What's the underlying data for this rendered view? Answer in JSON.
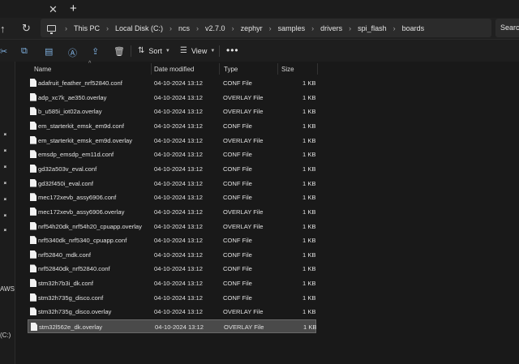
{
  "window": {
    "tab_close_glyph": "✕",
    "tab_new_glyph": "+"
  },
  "nav": {
    "up_icon": "arrow-up-icon",
    "refresh_icon": "refresh-icon"
  },
  "breadcrumb": [
    "This PC",
    "Local Disk (C:)",
    "ncs",
    "v2.7.0",
    "zephyr",
    "samples",
    "drivers",
    "spi_flash",
    "boards"
  ],
  "search": {
    "placeholder": "Search"
  },
  "toolbar": {
    "sort_label": "Sort",
    "view_label": "View",
    "more_label": "•••"
  },
  "sidebar": {
    "partial_labels": [
      "AWS",
      "(C:)"
    ]
  },
  "columns": {
    "name": "Name",
    "date": "Date modified",
    "type": "Type",
    "size": "Size"
  },
  "files": [
    {
      "name": "adafruit_feather_nrf52840.conf",
      "date": "04-10-2024 13:12",
      "type": "CONF File",
      "size": "1 KB"
    },
    {
      "name": "adp_xc7k_ae350.overlay",
      "date": "04-10-2024 13:12",
      "type": "OVERLAY File",
      "size": "1 KB"
    },
    {
      "name": "b_u585i_iot02a.overlay",
      "date": "04-10-2024 13:12",
      "type": "OVERLAY File",
      "size": "1 KB"
    },
    {
      "name": "em_starterkit_emsk_em9d.conf",
      "date": "04-10-2024 13:12",
      "type": "CONF File",
      "size": "1 KB"
    },
    {
      "name": "em_starterkit_emsk_em9d.overlay",
      "date": "04-10-2024 13:12",
      "type": "OVERLAY File",
      "size": "1 KB"
    },
    {
      "name": "emsdp_emsdp_em11d.conf",
      "date": "04-10-2024 13:12",
      "type": "CONF File",
      "size": "1 KB"
    },
    {
      "name": "gd32a503v_eval.conf",
      "date": "04-10-2024 13:12",
      "type": "CONF File",
      "size": "1 KB"
    },
    {
      "name": "gd32f450i_eval.conf",
      "date": "04-10-2024 13:12",
      "type": "CONF File",
      "size": "1 KB"
    },
    {
      "name": "mec172xevb_assy6906.conf",
      "date": "04-10-2024 13:12",
      "type": "CONF File",
      "size": "1 KB"
    },
    {
      "name": "mec172xevb_assy6906.overlay",
      "date": "04-10-2024 13:12",
      "type": "OVERLAY File",
      "size": "1 KB"
    },
    {
      "name": "nrf54h20dk_nrf54h20_cpuapp.overlay",
      "date": "04-10-2024 13:12",
      "type": "OVERLAY File",
      "size": "1 KB"
    },
    {
      "name": "nrf5340dk_nrf5340_cpuapp.conf",
      "date": "04-10-2024 13:12",
      "type": "CONF File",
      "size": "1 KB"
    },
    {
      "name": "nrf52840_mdk.conf",
      "date": "04-10-2024 13:12",
      "type": "CONF File",
      "size": "1 KB"
    },
    {
      "name": "nrf52840dk_nrf52840.conf",
      "date": "04-10-2024 13:12",
      "type": "CONF File",
      "size": "1 KB"
    },
    {
      "name": "stm32h7b3i_dk.conf",
      "date": "04-10-2024 13:12",
      "type": "CONF File",
      "size": "1 KB"
    },
    {
      "name": "stm32h735g_disco.conf",
      "date": "04-10-2024 13:12",
      "type": "CONF File",
      "size": "1 KB"
    },
    {
      "name": "stm32h735g_disco.overlay",
      "date": "04-10-2024 13:12",
      "type": "OVERLAY File",
      "size": "1 KB"
    },
    {
      "name": "stm32l562e_dk.overlay",
      "date": "04-10-2024 13:12",
      "type": "OVERLAY File",
      "size": "1 KB",
      "selected": true
    }
  ]
}
